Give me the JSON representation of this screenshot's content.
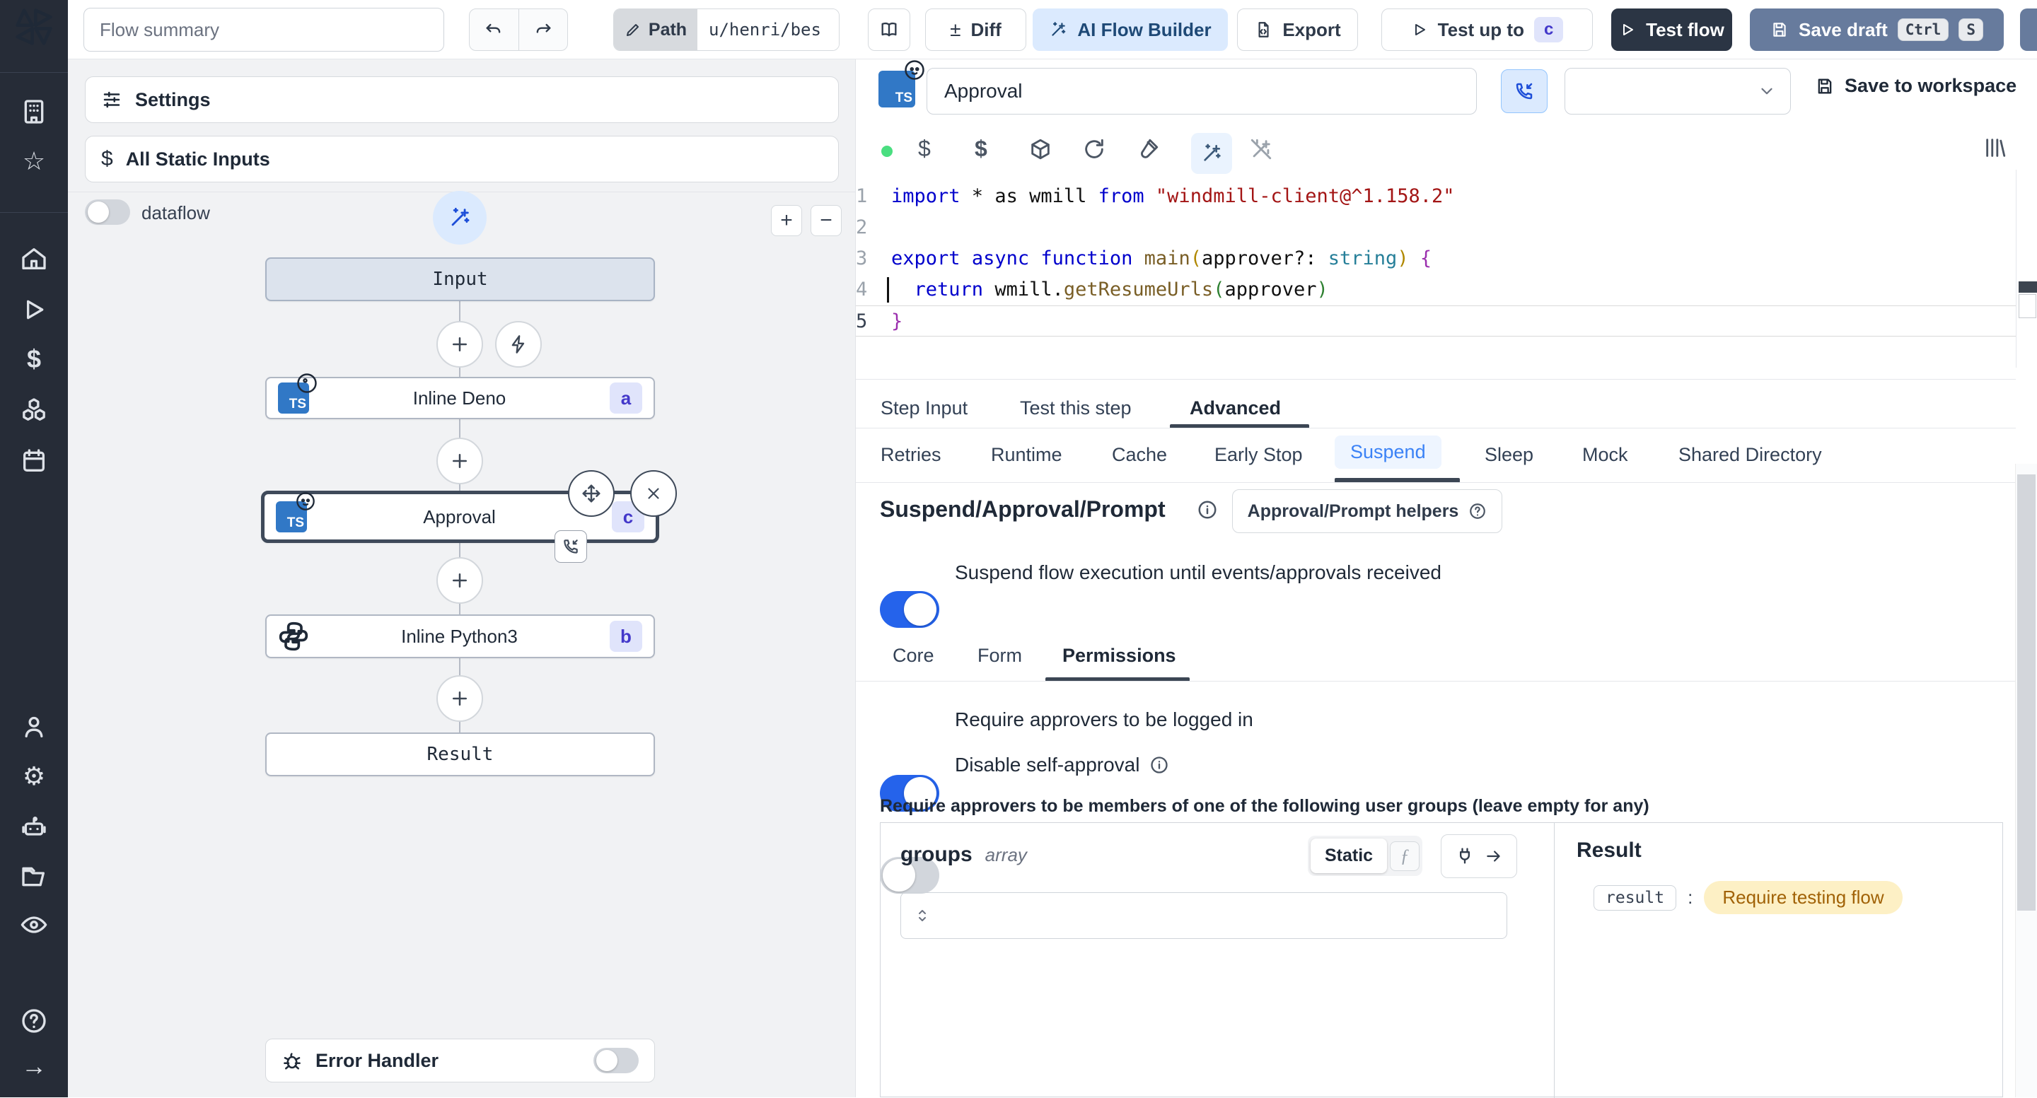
{
  "topbar": {
    "flow_summary_placeholder": "Flow summary",
    "path_label": "Path",
    "path_value": "u/henri/bes",
    "diff_label": "Diff",
    "ai_flow_builder_label": "AI Flow Builder",
    "export_label": "Export",
    "test_up_to_label": "Test up to",
    "test_up_to_badge": "c",
    "test_flow_label": "Test flow",
    "save_draft_label": "Save draft",
    "save_draft_kbd": [
      "Ctrl",
      "S"
    ]
  },
  "flow_panel": {
    "settings_label": "Settings",
    "all_static_inputs_label": "All Static Inputs",
    "dataflow_label": "dataflow",
    "nodes": {
      "input_label": "Input",
      "deno_label": "Inline Deno",
      "deno_badge": "a",
      "approval_label": "Approval",
      "approval_badge": "c",
      "python_label": "Inline Python3",
      "python_badge": "b",
      "result_label": "Result"
    },
    "error_handler_label": "Error Handler"
  },
  "step_editor": {
    "step_name_value": "Approval",
    "save_to_workspace_label": "Save to workspace",
    "tabs": {
      "items": [
        "Step Input",
        "Test this step",
        "Advanced"
      ],
      "active": "Advanced"
    },
    "subtabs": {
      "items": [
        "Retries",
        "Runtime",
        "Cache",
        "Early Stop",
        "Suspend",
        "Sleep",
        "Mock",
        "Shared Directory"
      ],
      "active": "Suspend"
    },
    "code": {
      "current_line": 4,
      "line_numbers": [
        "1",
        "2",
        "3",
        "4",
        "5"
      ],
      "lines": [
        [
          {
            "t": "import",
            "c": "kw"
          },
          {
            "t": " * as wmill ",
            "c": "pl"
          },
          {
            "t": "from",
            "c": "kw"
          },
          {
            "t": " ",
            "c": "pl"
          },
          {
            "t": "\"windmill-client@^1.158.2\"",
            "c": "str"
          }
        ],
        [],
        [
          {
            "t": "export",
            "c": "kw"
          },
          {
            "t": " ",
            "c": "pl"
          },
          {
            "t": "async",
            "c": "kw"
          },
          {
            "t": " ",
            "c": "pl"
          },
          {
            "t": "function",
            "c": "kw"
          },
          {
            "t": " ",
            "c": "pl"
          },
          {
            "t": "main",
            "c": "fn"
          },
          {
            "t": "(",
            "c": "bg"
          },
          {
            "t": "approver?: ",
            "c": "pl"
          },
          {
            "t": "string",
            "c": "ty"
          },
          {
            "t": ")",
            "c": "bg"
          },
          {
            "t": " ",
            "c": "pl"
          },
          {
            "t": "{",
            "c": "bp"
          }
        ],
        [
          {
            "t": "  ",
            "c": "pl"
          },
          {
            "t": "return",
            "c": "kw"
          },
          {
            "t": " wmill.",
            "c": "pl"
          },
          {
            "t": "getResumeUrls",
            "c": "fn"
          },
          {
            "t": "(",
            "c": "bgr"
          },
          {
            "t": "approver",
            "c": "pl"
          },
          {
            "t": ")",
            "c": "bgr"
          }
        ],
        [
          {
            "t": "}",
            "c": "bp"
          }
        ]
      ]
    }
  },
  "suspend_section": {
    "title": "Suspend/Approval/Prompt",
    "helpers_button_label": "Approval/Prompt helpers",
    "suspend_toggle_label": "Suspend flow execution until events/approvals received",
    "tabs": {
      "items": [
        "Core",
        "Form",
        "Permissions"
      ],
      "active": "Permissions"
    },
    "require_login_label": "Require approvers to be logged in",
    "disable_self_approval_label": "Disable self-approval",
    "groups_heading": "Require approvers to be members of one of the following user groups (leave empty for any)",
    "groups_field": {
      "name": "groups",
      "type": "array",
      "mode_static_label": "Static"
    },
    "result_panel": {
      "heading": "Result",
      "key": "result",
      "value": "Require testing flow"
    }
  },
  "colors": {
    "accent_blue": "#2563eb",
    "ai_chip_bg": "#dbeafe",
    "test_flow_bg": "#2b3544",
    "save_draft_bg": "#677b9d",
    "badge_bg": "#e0e4fb",
    "badge_text": "#4338ca",
    "result_value_bg": "#fdf0c5",
    "result_value_text": "#a16207",
    "status_dot": "#4ade80",
    "sidebar_bg": "#262c37"
  },
  "icons": [
    "windmill-logo",
    "workspace",
    "favorites",
    "home",
    "runs",
    "variables",
    "resources",
    "schedules",
    "user",
    "settings",
    "workers",
    "folders",
    "audit",
    "help",
    "expand-sidebar",
    "undo",
    "redo",
    "pencil",
    "book",
    "diff",
    "ai-wand",
    "export",
    "play",
    "save",
    "status-dot",
    "package",
    "reset",
    "vial",
    "library",
    "phone-incoming",
    "bug",
    "plug",
    "move",
    "close",
    "lightning",
    "info",
    "chevron-down",
    "chevron-sort"
  ]
}
